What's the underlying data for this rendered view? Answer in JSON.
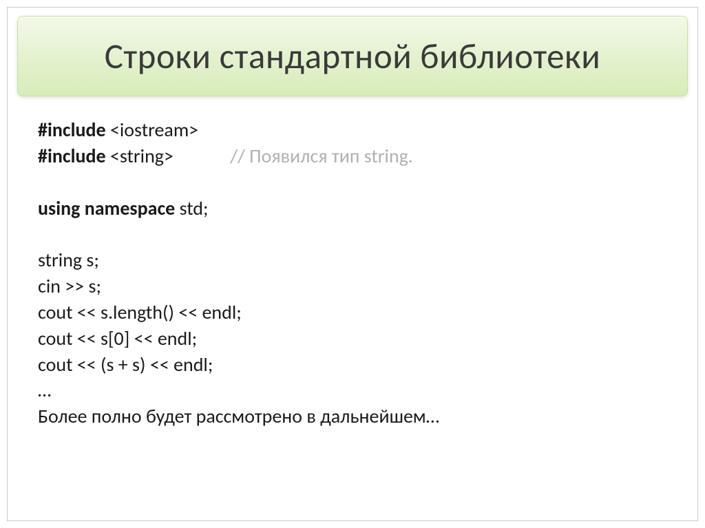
{
  "title": "Строки стандартной библиотеки",
  "code": {
    "line1_keyword": "#include",
    "line1_rest": " <iostream>",
    "line2_keyword": "#include",
    "line2_rest": " <string>",
    "line2_comment": "// Появился тип string.",
    "line3_keyword": "using namespace",
    "line3_rest": " std;",
    "line4": "string s;",
    "line5": "cin >> s;",
    "line6": "cout << s.length() << endl;",
    "line7": "cout << s[0] << endl;",
    "line8": "cout << (s + s) << endl;",
    "line9": "…",
    "line10": "Более полно будет рассмотрено в дальнейшем…"
  }
}
